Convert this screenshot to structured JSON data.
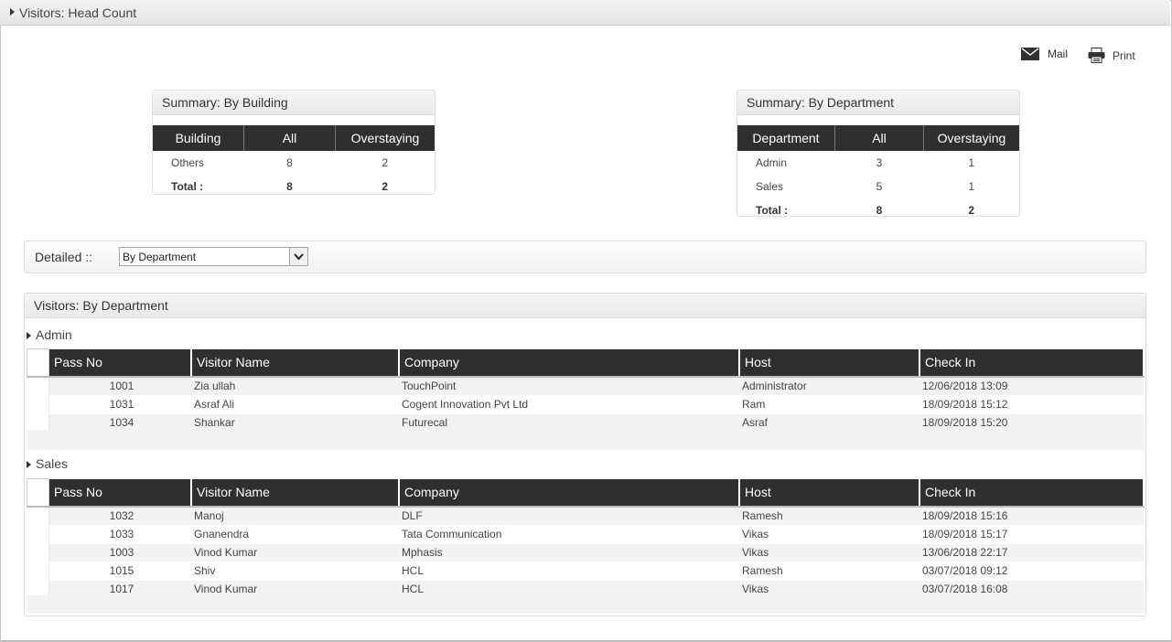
{
  "window": {
    "title": "Visitors: Head Count"
  },
  "actions": {
    "mail": "Mail",
    "print": "Print"
  },
  "summary_building": {
    "title": "Summary: By Building",
    "headers": [
      "Building",
      "All",
      "Overstaying"
    ],
    "rows": [
      {
        "name": "Others",
        "all": "8",
        "over": "2"
      }
    ],
    "total": {
      "label": "Total :",
      "all": "8",
      "over": "2"
    }
  },
  "summary_department": {
    "title": "Summary: By Department",
    "headers": [
      "Department",
      "All",
      "Overstaying"
    ],
    "rows": [
      {
        "name": "Admin",
        "all": "3",
        "over": "1"
      },
      {
        "name": "Sales",
        "all": "5",
        "over": "1"
      }
    ],
    "total": {
      "label": "Total :",
      "all": "8",
      "over": "2"
    }
  },
  "detailed": {
    "label": "Detailed ::",
    "selected": "By Department"
  },
  "visitors": {
    "title": "Visitors: By Department",
    "headers": [
      "Pass No",
      "Visitor Name",
      "Company",
      "Host",
      "Check In"
    ],
    "groups": [
      {
        "name": "Admin",
        "rows": [
          {
            "pass": "1001",
            "visitor": "Zia ullah",
            "company": "TouchPoint",
            "host": "Administrator",
            "checkin": "12/06/2018 13:09"
          },
          {
            "pass": "1031",
            "visitor": "Asraf Ali",
            "company": "Cogent Innovation Pvt Ltd",
            "host": "Ram",
            "checkin": "18/09/2018 15:12"
          },
          {
            "pass": "1034",
            "visitor": "Shankar",
            "company": "Futurecal",
            "host": "Asraf",
            "checkin": "18/09/2018 15:20"
          }
        ]
      },
      {
        "name": "Sales",
        "rows": [
          {
            "pass": "1032",
            "visitor": "Manoj",
            "company": "DLF",
            "host": "Ramesh",
            "checkin": "18/09/2018 15:16"
          },
          {
            "pass": "1033",
            "visitor": "Gnanendra",
            "company": "Tata Communication",
            "host": "Vikas",
            "checkin": "18/09/2018 15:17"
          },
          {
            "pass": "1003",
            "visitor": "Vinod Kumar",
            "company": "Mphasis",
            "host": "Vikas",
            "checkin": "13/06/2018 22:17"
          },
          {
            "pass": "1015",
            "visitor": "Shiv",
            "company": "HCL",
            "host": "Ramesh",
            "checkin": "03/07/2018 09:12"
          },
          {
            "pass": "1017",
            "visitor": "Vinod Kumar",
            "company": "HCL",
            "host": "Vikas",
            "checkin": "03/07/2018 16:08"
          }
        ]
      }
    ]
  }
}
